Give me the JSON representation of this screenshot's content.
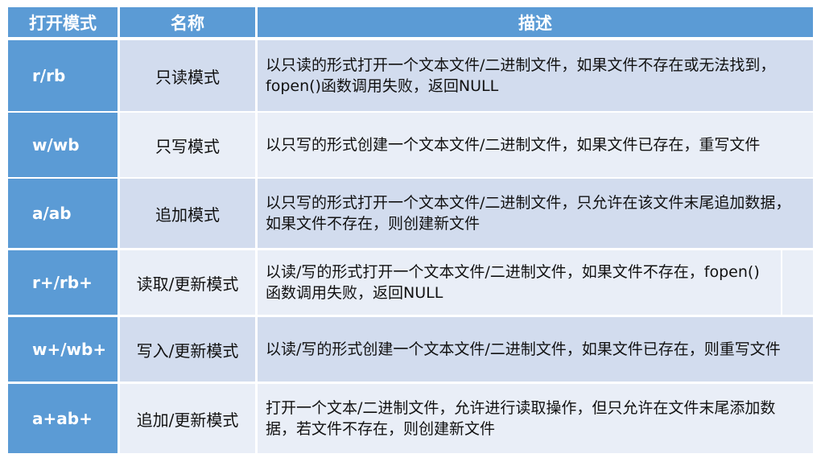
{
  "headers": [
    "打开模式",
    "名称",
    "描述"
  ],
  "rows": [
    {
      "mode": "r/rb",
      "name": "只读模式",
      "desc": "以只读的形式打开一个文本文件/二进制文件，如果文件不存在或无法找到，fopen()函数调用失败，返回NULL"
    },
    {
      "mode": "w/wb",
      "name": "只写模式",
      "desc": "以只写的形式创建一个文本文件/二进制文件，如果文件已存在，重写文件"
    },
    {
      "mode": "a/ab",
      "name": "追加模式",
      "desc": "以只写的形式打开一个文本文件/二进制文件，只允许在该文件末尾追加数据，如果文件不存在，则创建新文件"
    },
    {
      "mode": "r+/rb+",
      "name": "读取/更新模式",
      "desc": "以读/写的形式打开一个文本文件/二进制文件，如果文件不存在，fopen()函数调用失败，返回NULL"
    },
    {
      "mode": "w+/wb+",
      "name": "写入/更新模式",
      "desc": "以读/写的形式创建一个文本文件/二进制文件，如果文件已存在，则重写文件"
    },
    {
      "mode": "a+ab+",
      "name": "追加/更新模式",
      "desc": "打开一个文本/二进制文件，允许进行读取操作，但只允许在文件末尾添加数据，若文件不存在，则创建新文件"
    }
  ]
}
